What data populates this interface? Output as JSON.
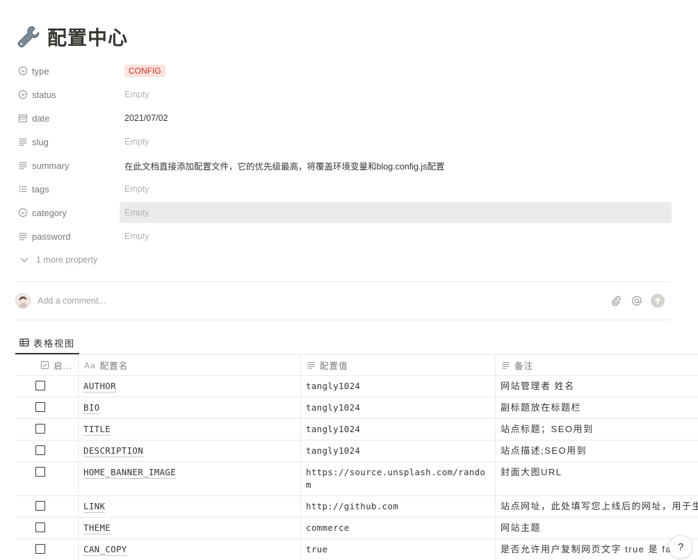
{
  "page": {
    "icon": "wrench-icon",
    "title": "配置中心"
  },
  "properties": [
    {
      "key": "type",
      "icon": "select-icon",
      "value": "CONFIG",
      "kind": "badge"
    },
    {
      "key": "status",
      "icon": "select-icon",
      "value": "Empty",
      "kind": "empty"
    },
    {
      "key": "date",
      "icon": "calendar-icon",
      "value": "2021/07/02",
      "kind": "text"
    },
    {
      "key": "slug",
      "icon": "text-lines-icon",
      "value": "Empty",
      "kind": "empty"
    },
    {
      "key": "summary",
      "icon": "text-lines-icon",
      "value": "在此文档直接添加配置文件，它的优先级最高，将覆盖环境变量和blog.config.js配置",
      "kind": "text"
    },
    {
      "key": "tags",
      "icon": "list-icon",
      "value": "Empty",
      "kind": "empty"
    },
    {
      "key": "category",
      "icon": "select-icon",
      "value": "Empty",
      "kind": "empty"
    },
    {
      "key": "password",
      "icon": "text-lines-icon",
      "value": "Empty",
      "kind": "empty"
    }
  ],
  "more_property": "1 more property",
  "comment": {
    "placeholder": "Add a comment..."
  },
  "view_tab": {
    "icon": "table-icon",
    "label": "表格视图"
  },
  "table": {
    "headers": [
      {
        "label": "启...",
        "icon": "checkbox-icon"
      },
      {
        "label": "配置名",
        "icon": "title-aa-icon",
        "prefix": "Aa"
      },
      {
        "label": "配置值",
        "icon": "text-lines-icon"
      },
      {
        "label": "备注",
        "icon": "text-lines-icon"
      }
    ],
    "rows": [
      {
        "key": "AUTHOR",
        "value": "tangly1024",
        "note": "网站管理者 姓名"
      },
      {
        "key": "BIO",
        "value": "tangly1024",
        "note": "副标题放在标题栏"
      },
      {
        "key": "TITLE",
        "value": "tangly1024",
        "note": "站点标题；SEO用到"
      },
      {
        "key": "DESCRIPTION",
        "value": "tangly1024",
        "note": "站点描述;SEO用到"
      },
      {
        "key": "HOME_BANNER_IMAGE",
        "value": "https://source.unsplash.com/random",
        "note": "封面大图URL"
      },
      {
        "key": "LINK",
        "value": "http://github.com",
        "note": "站点网址，此处填写您上线后的网址，用于生"
      },
      {
        "key": "THEME",
        "value": "commerce",
        "note": "网站主题"
      },
      {
        "key": "CAN_COPY",
        "value": "true",
        "note": "是否允许用户复制网页文字 true 是 false"
      }
    ]
  },
  "help": {
    "label": "?"
  },
  "colors": {
    "badge_bg": "#ffe2dd",
    "badge_text": "#c4302b",
    "highlight_bg": "#ebebea"
  }
}
